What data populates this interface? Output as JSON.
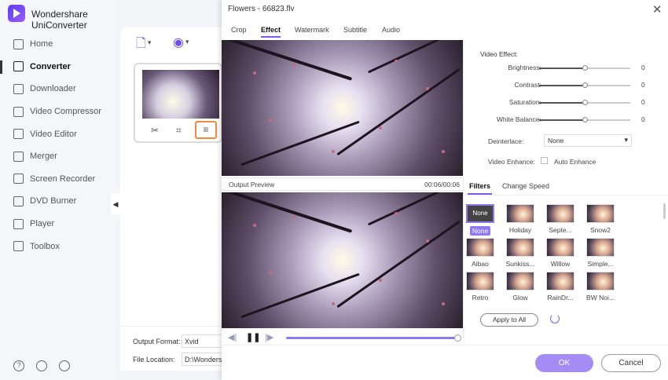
{
  "app": {
    "title": "Wondershare UniConverter"
  },
  "sidebar": {
    "items": [
      {
        "label": "Home",
        "icon": "home-icon"
      },
      {
        "label": "Converter",
        "icon": "converter-icon",
        "active": true
      },
      {
        "label": "Downloader",
        "icon": "download-icon"
      },
      {
        "label": "Video Compressor",
        "icon": "compress-icon"
      },
      {
        "label": "Video Editor",
        "icon": "scissors-icon"
      },
      {
        "label": "Merger",
        "icon": "merge-icon"
      },
      {
        "label": "Screen Recorder",
        "icon": "record-icon"
      },
      {
        "label": "DVD Burner",
        "icon": "disc-icon"
      },
      {
        "label": "Player",
        "icon": "play-icon"
      },
      {
        "label": "Toolbox",
        "icon": "grid-icon"
      }
    ],
    "bottom_icons": [
      "help-icon",
      "bell-icon",
      "feedback-icon"
    ]
  },
  "main": {
    "output_format_label": "Output Format:",
    "output_format_value": "Xvid",
    "file_location_label": "File Location:",
    "file_location_value": "D:\\Wonders"
  },
  "dialog": {
    "title": "Flowers - 66823.flv",
    "tabs": [
      "Crop",
      "Effect",
      "Watermark",
      "Subtitle",
      "Audio"
    ],
    "active_tab": "Effect",
    "output_preview_label": "Output Preview",
    "output_time": "00:06/00:06",
    "progress_fraction": 1.0,
    "video_effect_title": "Video Effect:",
    "sliders": [
      {
        "label": "Brightness:",
        "value": "0",
        "level": 0.5
      },
      {
        "label": "Contrast:",
        "value": "0",
        "level": 0.5
      },
      {
        "label": "Saturation:",
        "value": "0",
        "level": 0.5
      },
      {
        "label": "White Balance:",
        "value": "0",
        "level": 0.5
      }
    ],
    "deinterlace_label": "Deinterlace:",
    "deinterlace_value": "None",
    "video_enhance_label": "Video Enhance:",
    "auto_enhance_label": "Auto Enhance",
    "subtabs": [
      "Filters",
      "Change Speed"
    ],
    "active_subtab": "Filters",
    "filters": [
      "None",
      "Holiday",
      "Septe...",
      "Snow2",
      "Aibao",
      "Sunkiss...",
      "Willow",
      "Simple...",
      "Retro",
      "Glow",
      "RainDr...",
      "BW Noi..."
    ],
    "selected_filter": "None",
    "apply_all_label": "Apply to All",
    "ok_label": "OK",
    "cancel_label": "Cancel"
  }
}
